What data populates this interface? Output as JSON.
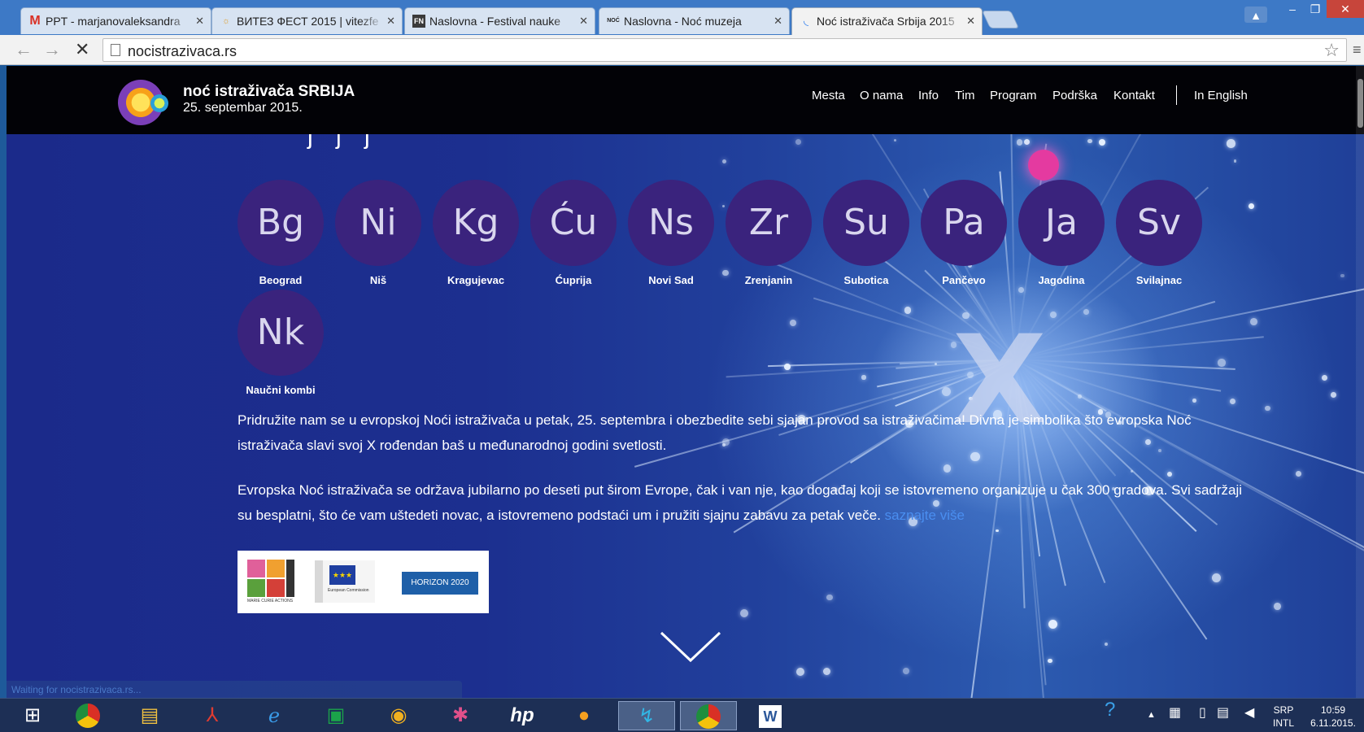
{
  "browser": {
    "tabs": [
      {
        "title": "PPT - marjanovaleksandra",
        "favicon": "M",
        "favicon_color": "#d93025"
      },
      {
        "title": "ВИТЕЗ ФЕСТ 2015 | vitezfe",
        "favicon": "☼",
        "favicon_color": "#e0a030"
      },
      {
        "title": "Naslovna - Festival nauke",
        "favicon": "FN",
        "favicon_color": "#ffffff"
      },
      {
        "title": "Naslovna - Noć muzeja",
        "favicon": "NOĆ",
        "favicon_color": "#222222"
      },
      {
        "title": "Noć istraživača Srbija 2015",
        "favicon": "◟",
        "favicon_color": "#4a8ef0"
      }
    ],
    "url": "nocistrazivaca.rs",
    "status_text": "Waiting for nocistrazivaca.rs..."
  },
  "site": {
    "brand_name": "noć istraživača SRBIJA",
    "brand_date": "25. septembar 2015.",
    "nav": [
      "Mesta",
      "O nama",
      "Info",
      "Tim",
      "Program",
      "Podrška",
      "Kontakt"
    ],
    "language_link": "In English",
    "hidden_heading_fragment": "j  j  j",
    "cities": [
      {
        "abbr": "Bg",
        "name": "Beograd"
      },
      {
        "abbr": "Ni",
        "name": "Niš"
      },
      {
        "abbr": "Kg",
        "name": "Kragujevac"
      },
      {
        "abbr": "Ću",
        "name": "Ćuprija"
      },
      {
        "abbr": "Ns",
        "name": "Novi Sad"
      },
      {
        "abbr": "Zr",
        "name": "Zrenjanin"
      },
      {
        "abbr": "Su",
        "name": "Subotica"
      },
      {
        "abbr": "Pa",
        "name": "Pančevo"
      },
      {
        "abbr": "Ja",
        "name": "Jagodina"
      },
      {
        "abbr": "Sv",
        "name": "Svilajnac"
      },
      {
        "abbr": "Nk",
        "name": "Naučni kombi"
      }
    ],
    "paragraph1": "Pridružite nam se u evropskoj Noći istraživača u petak, 25. septembra i obezbedite sebi sjajan provod sa istraživačima! Divna je simbolika što evropska Noć istraživača slavi svoj X rođendan baš u međunarodnoj godini svetlosti.",
    "paragraph2": "Evropska Noć istraživača se održava jubilarno po deseti put širom Evrope, čak i van nje, kao događaj koji se istovremeno organizuje u čak 300 gradova. Svi sadržaji su besplatni, što će vam uštedeti novac, a istovremeno podstaći um i pružiti sjajnu zabavu za petak veče.",
    "read_more": "saznajte više",
    "partner_logos": {
      "marie_curie": "MARIE CURIE ACTIONS",
      "eu": "European Commission",
      "horizon": "HORIZON 2020"
    },
    "big_mark": "X"
  },
  "taskbar": {
    "apps": [
      "windows-start",
      "chrome",
      "file-explorer",
      "acrobat",
      "internet-explorer",
      "store",
      "media-player",
      "paint",
      "hp",
      "balloon",
      "network-app",
      "chrome-active",
      "word"
    ],
    "language": "SRP",
    "keyboard": "INTL",
    "time": "10:59",
    "date": "6.11.2015."
  }
}
